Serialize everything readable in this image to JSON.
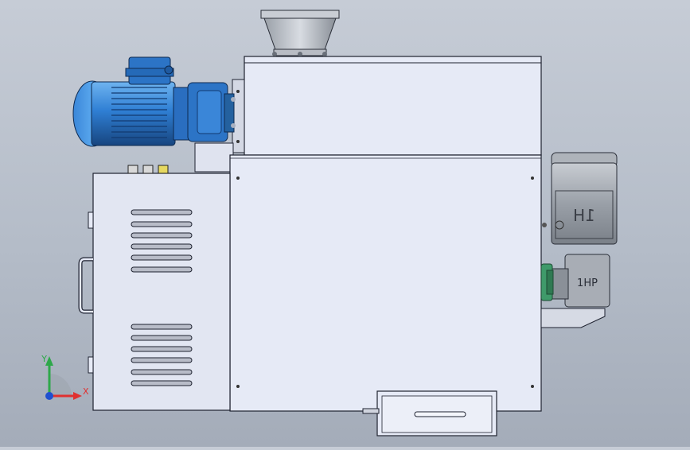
{
  "viewport": {
    "background_top": "#c6ccd6",
    "background_bottom": "#a4acb9"
  },
  "machine": {
    "body_color": "#e6eaf6",
    "outline_color": "#1e2230",
    "motor_color": "#2f7fd4",
    "motor_dark": "#1c4f96",
    "secondary_motor_color": "#9aa0a8",
    "motor_plate_text": "1H",
    "gearbox_label": "1HP"
  },
  "triad": {
    "x_label": "X",
    "y_label": "Y",
    "x_color": "#e03030",
    "y_color": "#2ea84a",
    "z_color": "#2050d0"
  }
}
